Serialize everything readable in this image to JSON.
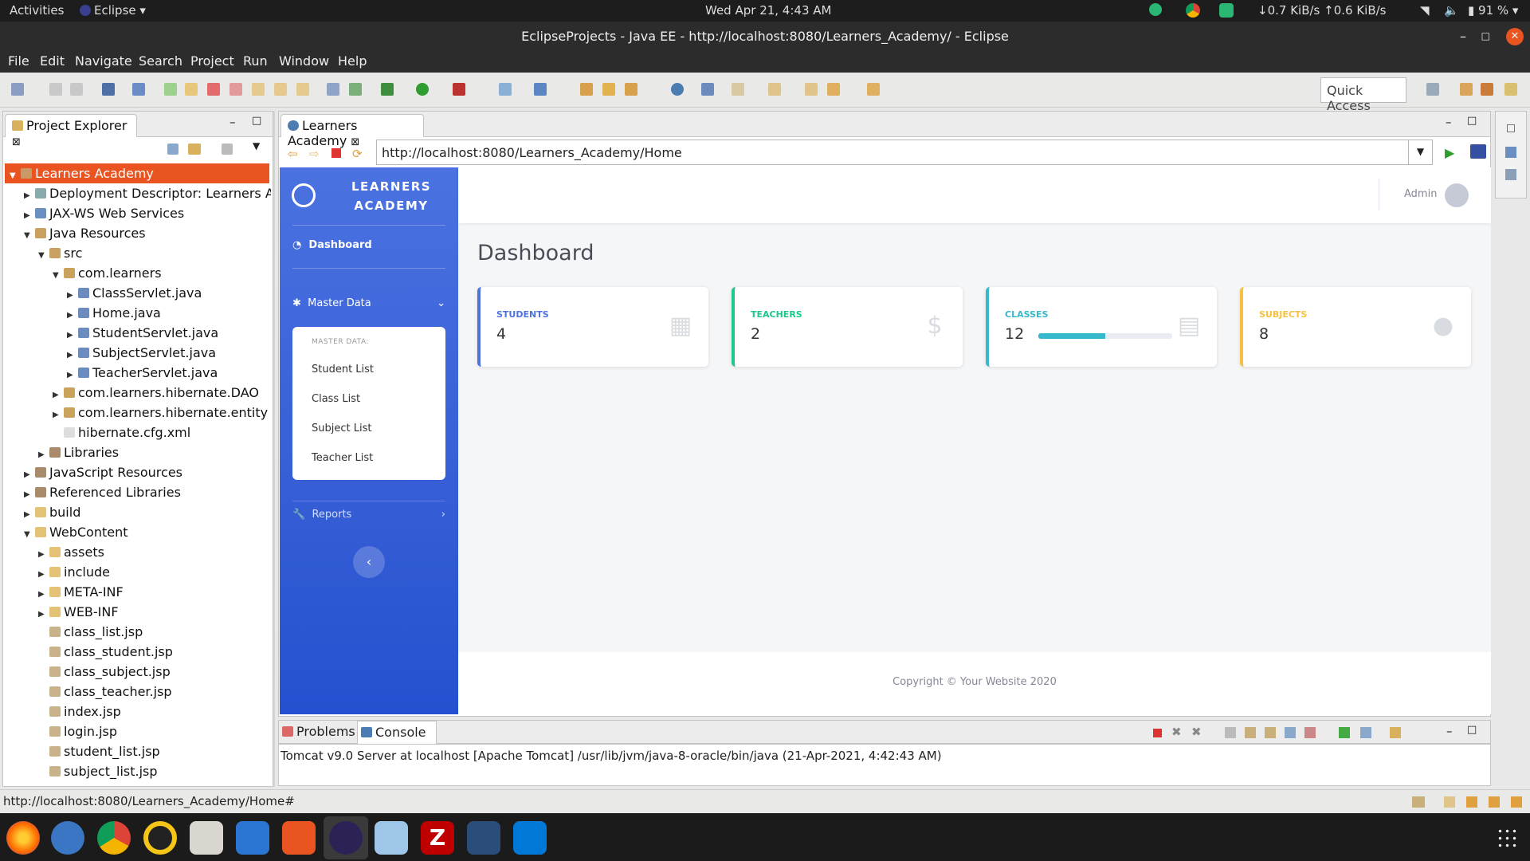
{
  "topbar": {
    "activities": "Activities",
    "app": "Eclipse",
    "clock": "Wed Apr 21,  4:43 AM",
    "net": "↓0.7 KiB/s ↑0.6 KiB/s",
    "battery": "91 %"
  },
  "window": {
    "title": "EclipseProjects - Java EE - http://localhost:8080/Learners_Academy/ - Eclipse"
  },
  "menu": [
    "File",
    "Edit",
    "Navigate",
    "Search",
    "Project",
    "Run",
    "Window",
    "Help"
  ],
  "quick_access": "Quick Access",
  "explorer": {
    "title": "Project Explorer",
    "items": [
      {
        "label": "Learners Academy",
        "indent": 0,
        "tw": "▼",
        "icon": "project",
        "selected": true
      },
      {
        "label": "Deployment Descriptor: Learners Acad",
        "indent": 1,
        "tw": "▶",
        "icon": "descriptor"
      },
      {
        "label": "JAX-WS Web Services",
        "indent": 1,
        "tw": "▶",
        "icon": "ws"
      },
      {
        "label": "Java Resources",
        "indent": 1,
        "tw": "▼",
        "icon": "jres"
      },
      {
        "label": "src",
        "indent": 2,
        "tw": "▼",
        "icon": "srcfolder"
      },
      {
        "label": "com.learners",
        "indent": 3,
        "tw": "▼",
        "icon": "package"
      },
      {
        "label": "ClassServlet.java",
        "indent": 4,
        "tw": "▶",
        "icon": "java"
      },
      {
        "label": "Home.java",
        "indent": 4,
        "tw": "▶",
        "icon": "java"
      },
      {
        "label": "StudentServlet.java",
        "indent": 4,
        "tw": "▶",
        "icon": "java"
      },
      {
        "label": "SubjectServlet.java",
        "indent": 4,
        "tw": "▶",
        "icon": "java"
      },
      {
        "label": "TeacherServlet.java",
        "indent": 4,
        "tw": "▶",
        "icon": "java"
      },
      {
        "label": "com.learners.hibernate.DAO",
        "indent": 3,
        "tw": "▶",
        "icon": "package"
      },
      {
        "label": "com.learners.hibernate.entity",
        "indent": 3,
        "tw": "▶",
        "icon": "package"
      },
      {
        "label": "hibernate.cfg.xml",
        "indent": 3,
        "tw": "",
        "icon": "xml"
      },
      {
        "label": "Libraries",
        "indent": 2,
        "tw": "▶",
        "icon": "lib"
      },
      {
        "label": "JavaScript Resources",
        "indent": 1,
        "tw": "▶",
        "icon": "lib"
      },
      {
        "label": "Referenced Libraries",
        "indent": 1,
        "tw": "▶",
        "icon": "lib"
      },
      {
        "label": "build",
        "indent": 1,
        "tw": "▶",
        "icon": "folder"
      },
      {
        "label": "WebContent",
        "indent": 1,
        "tw": "▼",
        "icon": "folder"
      },
      {
        "label": "assets",
        "indent": 2,
        "tw": "▶",
        "icon": "folder"
      },
      {
        "label": "include",
        "indent": 2,
        "tw": "▶",
        "icon": "folder"
      },
      {
        "label": "META-INF",
        "indent": 2,
        "tw": "▶",
        "icon": "folder"
      },
      {
        "label": "WEB-INF",
        "indent": 2,
        "tw": "▶",
        "icon": "folder"
      },
      {
        "label": "class_list.jsp",
        "indent": 2,
        "tw": "",
        "icon": "jsp"
      },
      {
        "label": "class_student.jsp",
        "indent": 2,
        "tw": "",
        "icon": "jsp"
      },
      {
        "label": "class_subject.jsp",
        "indent": 2,
        "tw": "",
        "icon": "jsp"
      },
      {
        "label": "class_teacher.jsp",
        "indent": 2,
        "tw": "",
        "icon": "jsp"
      },
      {
        "label": "index.jsp",
        "indent": 2,
        "tw": "",
        "icon": "jsp"
      },
      {
        "label": "login.jsp",
        "indent": 2,
        "tw": "",
        "icon": "jsp"
      },
      {
        "label": "student_list.jsp",
        "indent": 2,
        "tw": "",
        "icon": "jsp"
      },
      {
        "label": "subject_list.jsp",
        "indent": 2,
        "tw": "",
        "icon": "jsp"
      }
    ]
  },
  "browser": {
    "tab": "Learners Academy",
    "url": "http://localhost:8080/Learners_Academy/Home"
  },
  "site": {
    "brand_line1": "LEARNERS",
    "brand_line2": "ACADEMY",
    "nav_dashboard": "Dashboard",
    "nav_master": "Master Data",
    "master_header": "MASTER DATA:",
    "master_items": [
      "Student List",
      "Class List",
      "Subject List",
      "Teacher List"
    ],
    "nav_reports": "Reports",
    "user": "Admin",
    "heading": "Dashboard",
    "footer": "Copyright © Your Website 2020",
    "stats": [
      {
        "label": "STUDENTS",
        "value": "4",
        "color": "#4e73df",
        "icon": "calendar-icon"
      },
      {
        "label": "TEACHERS",
        "value": "2",
        "color": "#1cc88a",
        "icon": "dollar-icon"
      },
      {
        "label": "CLASSES",
        "value": "12",
        "color": "#36b9cc",
        "icon": "clipboard-icon",
        "progress": 0.5
      },
      {
        "label": "SUBJECTS",
        "value": "8",
        "color": "#f6c23e",
        "icon": "comments-icon"
      }
    ]
  },
  "console": {
    "tab_problems": "Problems",
    "tab_console": "Console",
    "line": "Tomcat v9.0 Server at localhost [Apache Tomcat] /usr/lib/jvm/java-8-oracle/bin/java (21-Apr-2021, 4:42:43 AM)"
  },
  "status": {
    "text": "http://localhost:8080/Learners_Academy/Home#"
  },
  "colors": {
    "accent": "#e95420",
    "sidebar": "#4e73df"
  }
}
